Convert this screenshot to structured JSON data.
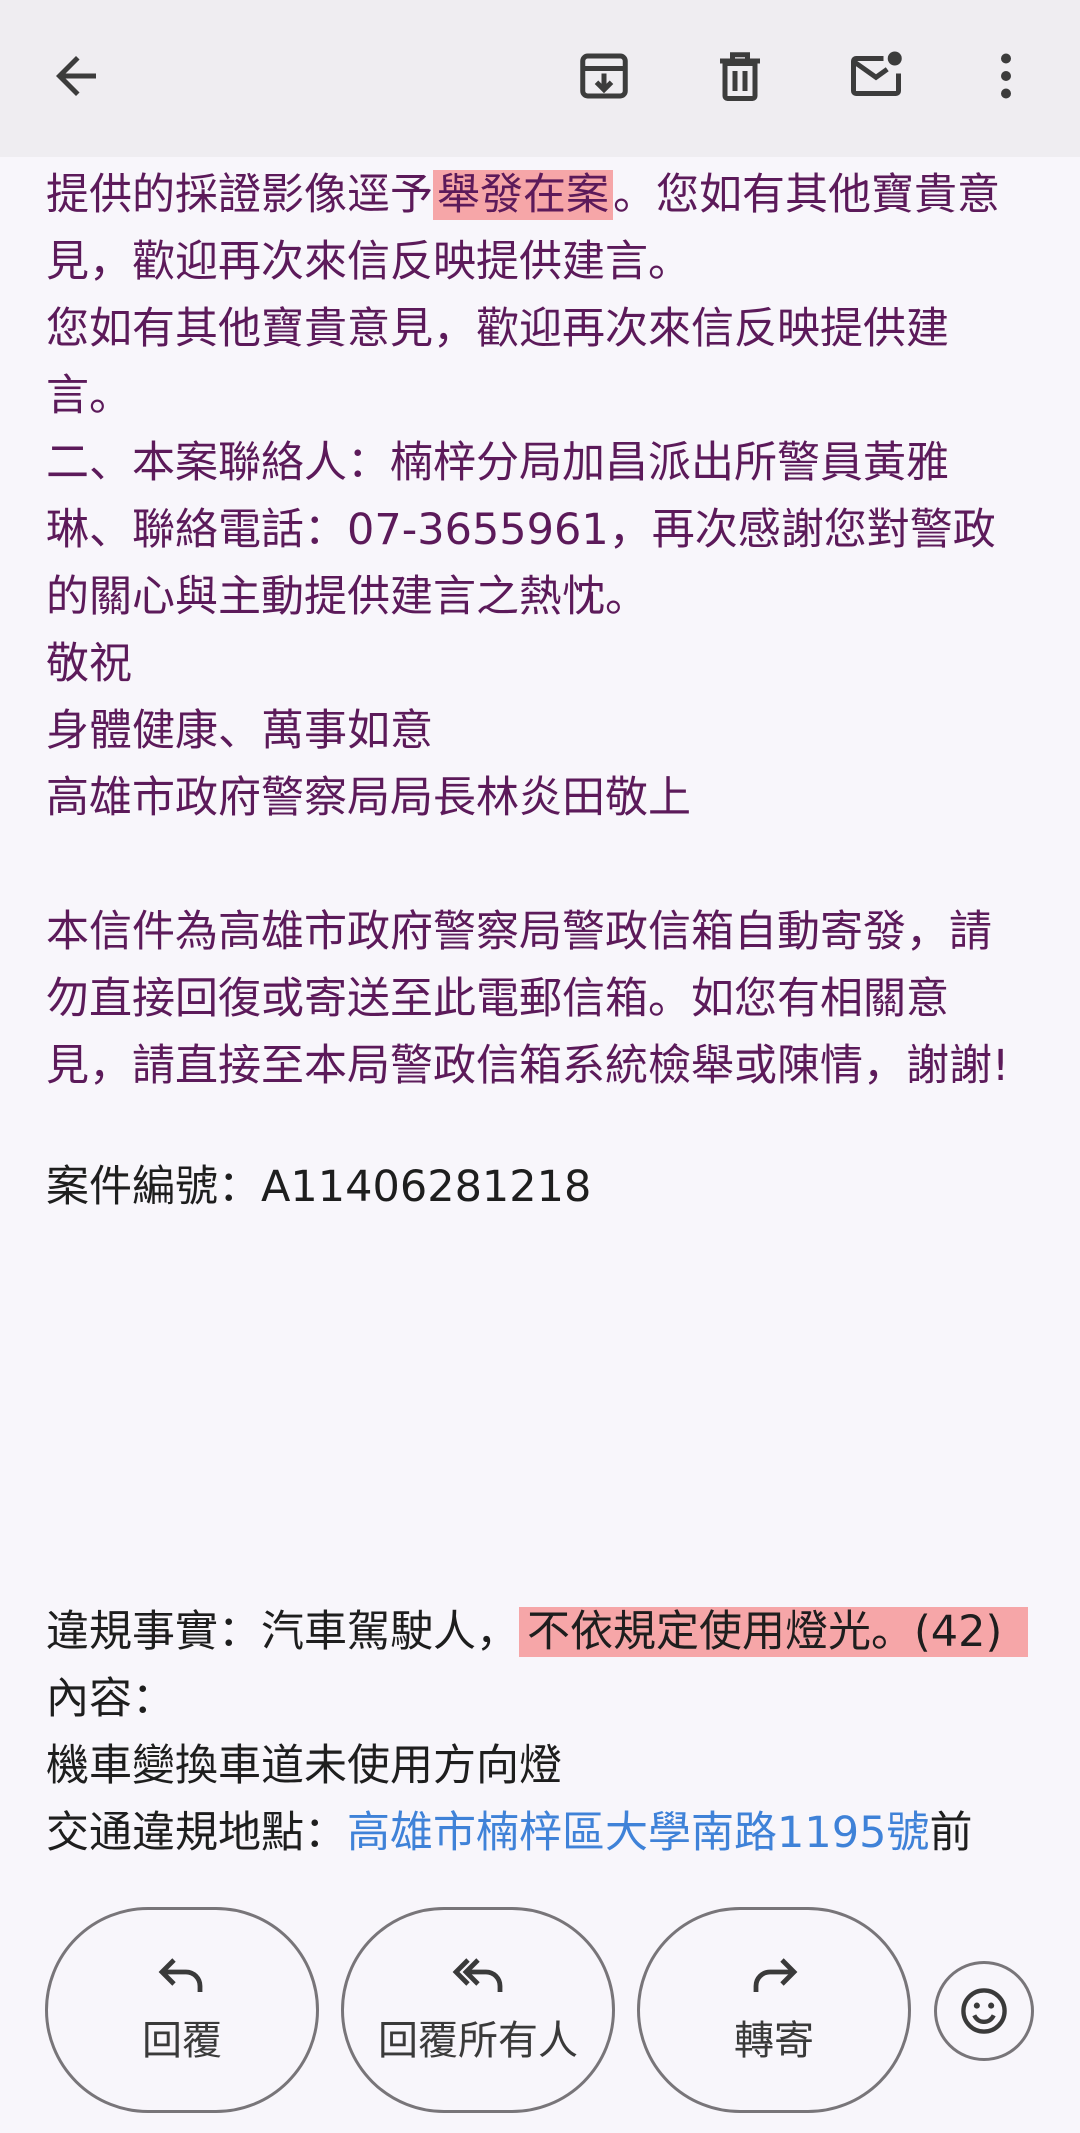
{
  "email_body": {
    "lines": [
      {
        "before": "提供的採證影像逕予",
        "highlight": "舉發在案",
        "after": "。您如有其他寶貴意"
      },
      "見，歡迎再次來信反映提供建言。",
      "您如有其他寶貴意見，歡迎再次來信反映提供建",
      "言。",
      "二、本案聯絡人：楠梓分局加昌派出所警員黃雅",
      "琳、聯絡電話：07-3655961，再次感謝您對警政",
      "的關心與主動提供建言之熱忱。",
      "敬祝",
      "身體健康、萬事如意",
      "高雄市政府警察局局長林炎田敬上"
    ],
    "notice_lines": [
      "本信件為高雄市政府警察局警政信箱自動寄發，請",
      "勿直接回復或寄送至此電郵信箱。如您有相關意",
      "見，請直接至本局警政信箱系統檢舉或陳情，謝謝!"
    ],
    "case_number": "案件編號：A11406281218"
  },
  "violation": {
    "fact_prefix": "違規事實：汽車駕駛人，",
    "fact_highlight": "不依規定使用燈光。(42)",
    "content_label": "內容：",
    "content_text": "機車變換車道未使用方向燈",
    "location_label": "交通違規地點：",
    "location_link": "高雄市楠梓區大學南路1195號",
    "location_suffix": "前"
  },
  "actions": {
    "reply": "回覆",
    "reply_all": "回覆所有人",
    "forward": "轉寄"
  },
  "colors": {
    "body_text": "#5c1a5a",
    "highlight": "#f6a6a8",
    "link": "#3f82d8",
    "topbar": "#efedf1"
  }
}
